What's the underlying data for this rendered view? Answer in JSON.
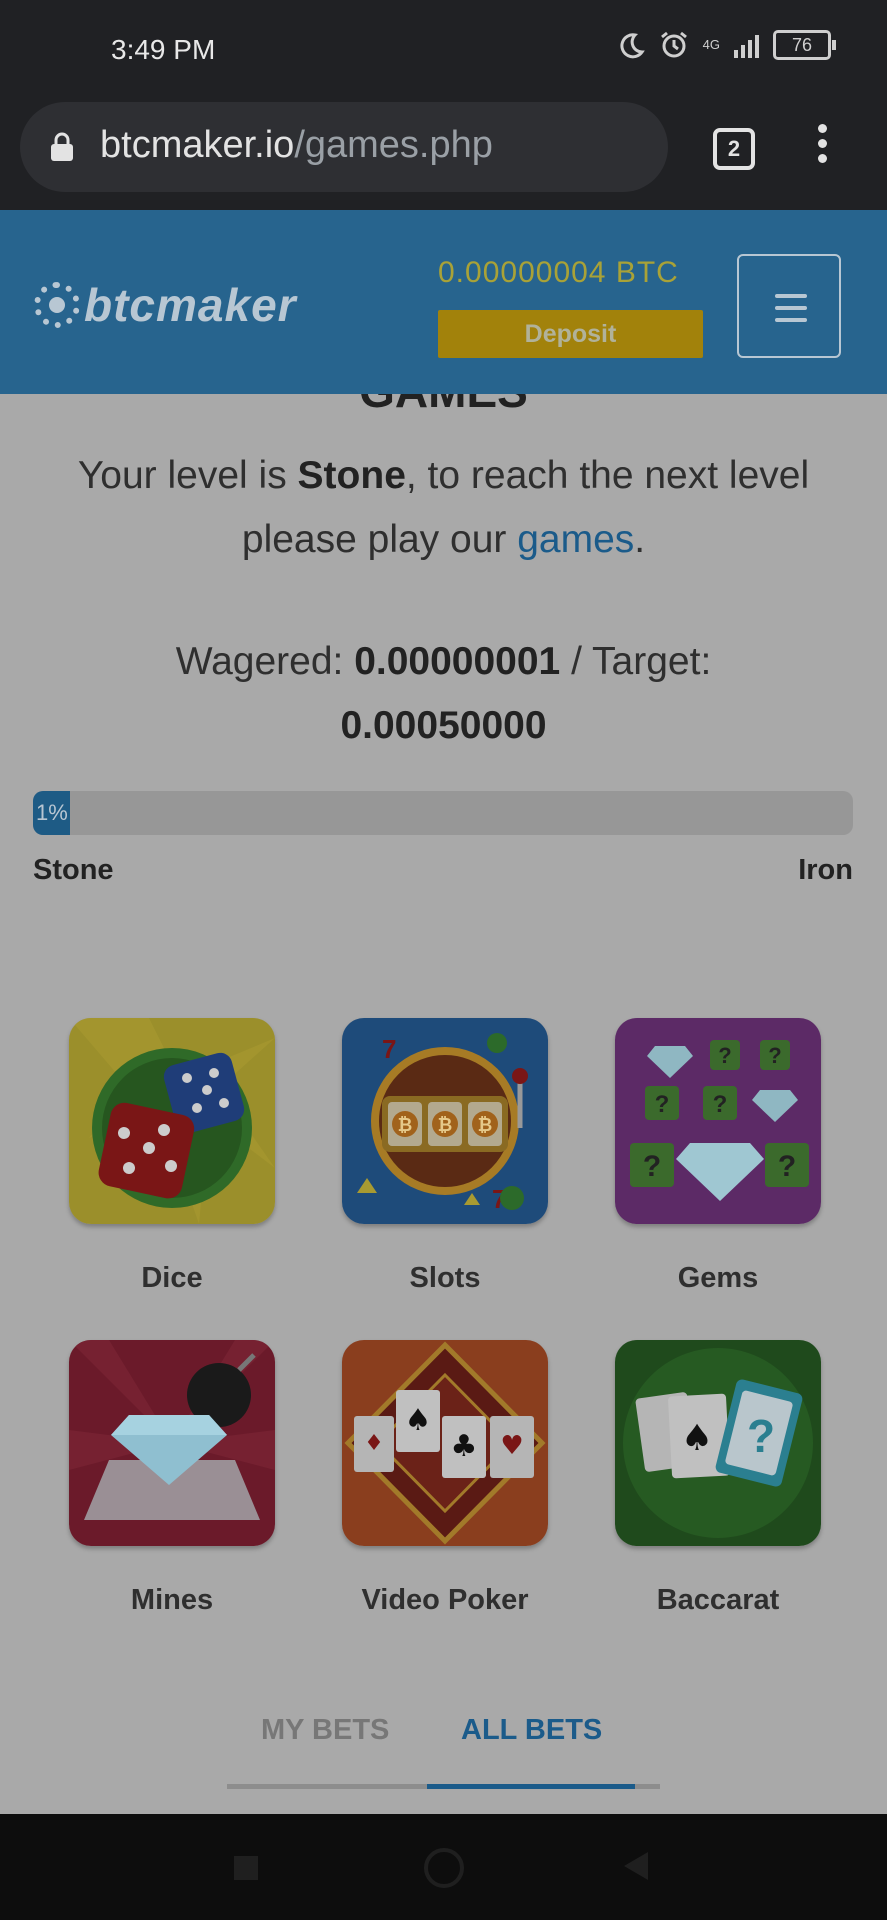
{
  "status_bar": {
    "time": "3:49 PM",
    "network": "4G",
    "battery": "76"
  },
  "browser": {
    "url_host": "btcmaker.io",
    "url_path": "/games.php",
    "tab_count": "2"
  },
  "header": {
    "logo": "btcmaker",
    "balance": "0.00000004 BTC",
    "deposit_label": "Deposit"
  },
  "page": {
    "heading": "GAMES",
    "level_prefix": "Your level is ",
    "level_name": "Stone",
    "level_middle": ", to reach the next level please play our ",
    "games_link": "games",
    "level_suffix": ".",
    "wagered_label": "Wagered: ",
    "wagered_value": "0.00000001",
    "target_label": " / Target: ",
    "target_value": "0.00050000",
    "progress_fraction": 0.01,
    "progress_label": "1%",
    "current_level": "Stone",
    "next_level": "Iron"
  },
  "games": [
    {
      "name": "Dice",
      "icon": "dice-icon"
    },
    {
      "name": "Slots",
      "icon": "slots-icon"
    },
    {
      "name": "Gems",
      "icon": "gems-icon"
    },
    {
      "name": "Mines",
      "icon": "mines-icon"
    },
    {
      "name": "Video Poker",
      "icon": "video-poker-icon"
    },
    {
      "name": "Baccarat",
      "icon": "baccarat-icon"
    }
  ],
  "bets_tabs": {
    "my_bets": "MY BETS",
    "all_bets": "ALL BETS",
    "active": "ALL BETS"
  },
  "colors": {
    "header_bg": "#27648e",
    "accent": "#1b5b8a",
    "deposit": "#a2820b",
    "balance": "#a9a237"
  }
}
